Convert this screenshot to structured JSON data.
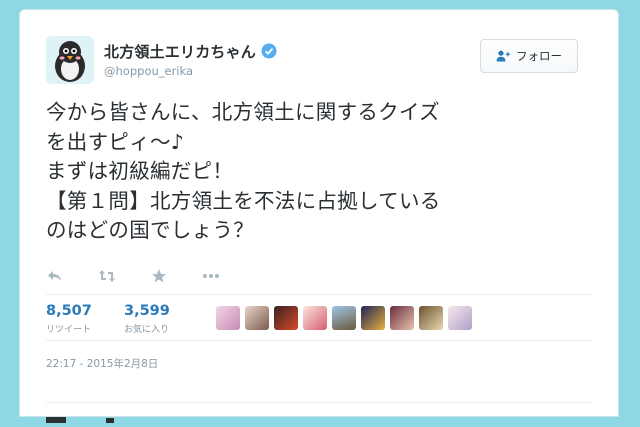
{
  "tweet": {
    "display_name": "北方領土エリカちゃん",
    "handle": "@hoppou_erika",
    "verified_icon": "verified-badge-icon",
    "follow_label": "フォロー",
    "text": "今から皆さんに、北方領土に関するクイズ\nを出すピィ〜♪\nまずは初級編だピ！\n【第１問】北方領土を不法に占拠している\nのはどの国でしょう？",
    "stats": {
      "retweets": {
        "count": "8,507",
        "label": "リツイート"
      },
      "likes": {
        "count": "3,599",
        "label": "お気に入り"
      }
    },
    "timestamp": "22:17 - 2015年2月8日",
    "actions": [
      "reply-icon",
      "retweet-icon",
      "favorite-icon",
      "more-icon"
    ]
  },
  "colors": {
    "page_background": "#8ed8e6",
    "link_blue": "#2b7bb9",
    "verified_blue": "#55acee",
    "muted": "#8899a6"
  },
  "liker_avatars": [
    "liker-avatar",
    "liker-avatar",
    "liker-avatar",
    "liker-avatar",
    "liker-avatar",
    "liker-avatar",
    "liker-avatar",
    "liker-avatar",
    "liker-avatar"
  ]
}
